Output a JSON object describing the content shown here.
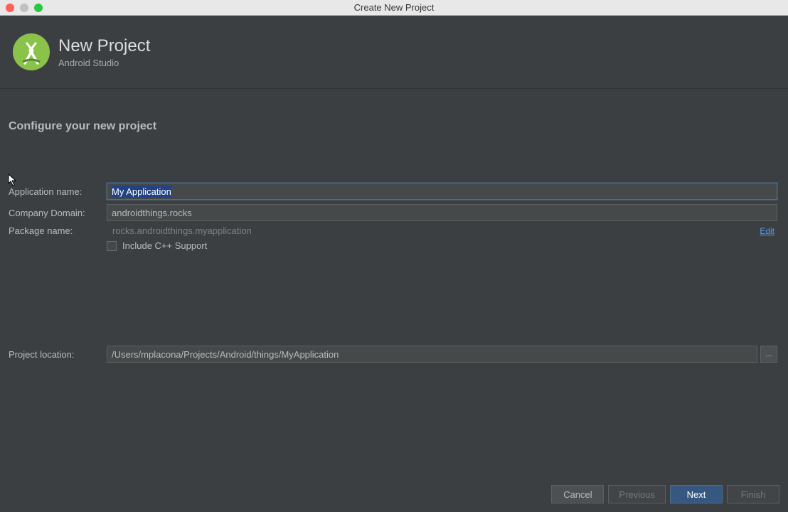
{
  "window": {
    "title": "Create New Project"
  },
  "header": {
    "title": "New Project",
    "subtitle": "Android Studio"
  },
  "section": {
    "title": "Configure your new project"
  },
  "form": {
    "app_name_label": "Application name:",
    "app_name_value": "My Application",
    "company_domain_label": "Company Domain:",
    "company_domain_value": "androidthings.rocks",
    "package_name_label": "Package name:",
    "package_name_value": "rocks.androidthings.myapplication",
    "edit_link": "Edit",
    "cpp_checkbox_label": "Include C++ Support",
    "location_label": "Project location:",
    "location_value": "/Users/mplacona/Projects/Android/things/MyApplication",
    "browse_label": "..."
  },
  "footer": {
    "cancel": "Cancel",
    "previous": "Previous",
    "next": "Next",
    "finish": "Finish"
  }
}
